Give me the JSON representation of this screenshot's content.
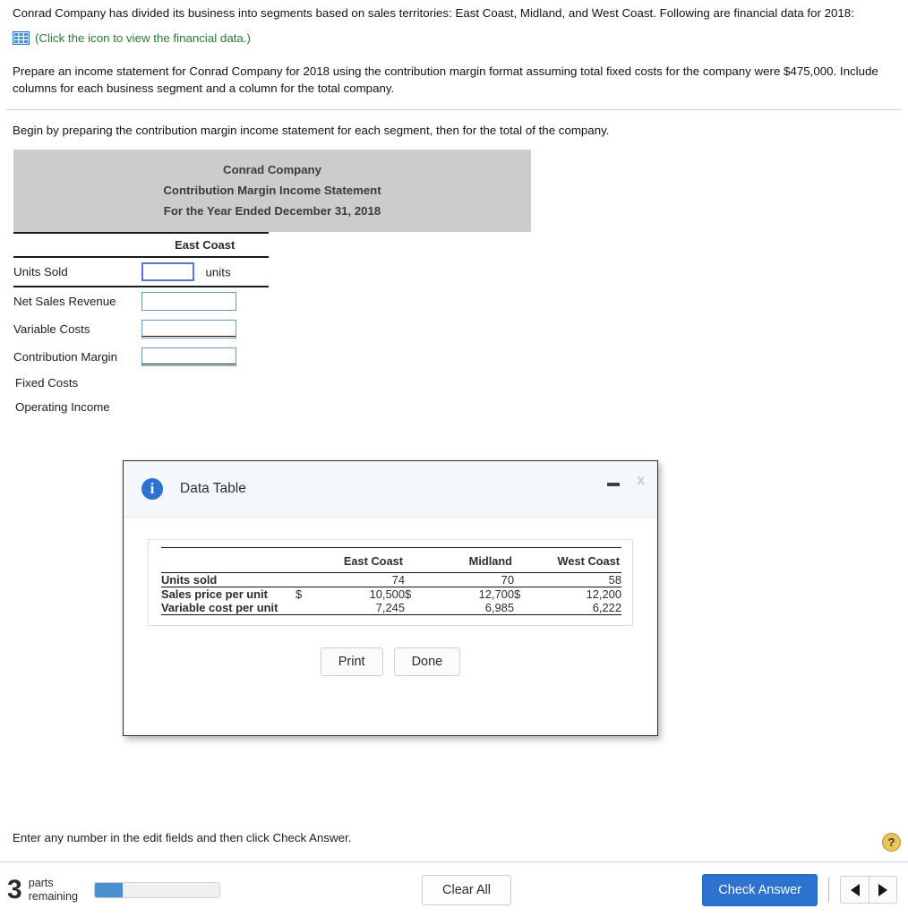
{
  "problem": {
    "paragraph1": "Conrad Company has divided its business into segments based on sales territories: East Coast, Midland, and West Coast. Following are financial data for 2018:",
    "icon_name": "spreadsheet-icon",
    "icon_link_text": "(Click the icon to view the financial data.)",
    "paragraph2": "Prepare an income statement for Conrad Company for 2018 using the contribution margin format assuming total fixed costs for the company were $475,000. Include columns for each business segment and a column for the total company."
  },
  "statement": {
    "instruction": "Begin by preparing the contribution margin income statement for each segment, then for the total of the company.",
    "header_lines": [
      "Conrad Company",
      "Contribution Margin Income Statement",
      "For the Year Ended December 31, 2018"
    ],
    "column_header": "East Coast",
    "rows": [
      {
        "label": "Units Sold",
        "field": true,
        "value": "",
        "suffix": "units",
        "focused": true,
        "rule": "none"
      },
      {
        "label": "Net Sales Revenue",
        "field": true,
        "value": "",
        "suffix": "",
        "focused": false,
        "rule": "none"
      },
      {
        "label": "Variable Costs",
        "field": true,
        "value": "",
        "suffix": "",
        "focused": false,
        "rule": "single"
      },
      {
        "label": "Contribution Margin",
        "field": true,
        "value": "",
        "suffix": "",
        "focused": false,
        "rule": "double"
      },
      {
        "label": "Fixed Costs",
        "field": false,
        "value": "",
        "suffix": "",
        "focused": false,
        "rule": "none"
      },
      {
        "label": "Operating Income",
        "field": false,
        "value": "",
        "suffix": "",
        "focused": false,
        "rule": "none"
      }
    ]
  },
  "modal": {
    "title": "Data Table",
    "info_icon": "info-icon",
    "minimize_label": "minimize-icon",
    "close_label": "x",
    "table": {
      "columns": [
        "",
        "East Coast",
        "Midland",
        "West Coast"
      ],
      "rows": [
        {
          "label": "Units sold",
          "dollar": "",
          "east": "74",
          "dollar2": "",
          "midland": "70",
          "dollar3": "",
          "west": "58"
        },
        {
          "label": "Sales price per unit",
          "dollar": "$",
          "east": "10,500",
          "dollar2": "$",
          "midland": "12,700",
          "dollar3": "$",
          "west": "12,200"
        },
        {
          "label": "Variable cost per unit",
          "dollar": "",
          "east": "7,245",
          "dollar2": "",
          "midland": "6,985",
          "dollar3": "",
          "west": "6,222"
        }
      ]
    },
    "print_label": "Print",
    "done_label": "Done"
  },
  "footer": {
    "hint": "Enter any number in the edit fields and then click Check Answer.",
    "help_label": "?",
    "parts_number": "3",
    "parts_line1": "parts",
    "parts_line2": "remaining",
    "progress_percent": 22,
    "clear_all_label": "Clear All",
    "check_answer_label": "Check Answer",
    "prev_label": "previous-arrow",
    "next_label": "next-arrow"
  },
  "colors": {
    "accent_blue": "#2d72ce",
    "link_green": "#2a7a34",
    "header_gray": "#cccccc",
    "help_gold": "#e8c35e"
  }
}
